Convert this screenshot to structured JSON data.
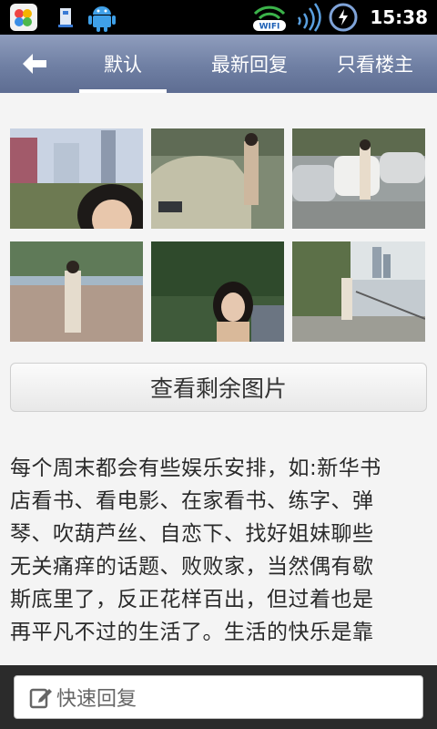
{
  "status_bar": {
    "time": "15:38",
    "wifi_label": "WIFI",
    "icons": [
      "app-store-icon",
      "usb-icon",
      "android-icon",
      "wifi-icon",
      "signal-icon",
      "battery-charging-icon"
    ]
  },
  "nav": {
    "back_icon": "back-arrow-icon",
    "tabs": [
      {
        "label": "默认",
        "active": true
      },
      {
        "label": "最新回复",
        "active": false
      },
      {
        "label": "只看楼主",
        "active": false
      }
    ]
  },
  "photos": {
    "items": [
      "photo-1",
      "photo-2",
      "photo-3",
      "photo-4",
      "photo-5",
      "photo-6"
    ],
    "more_button_label": "查看剩余图片"
  },
  "post": {
    "lines": [
      "每个周末都会有些娱乐安排，如:新华书",
      "店看书、看电影、在家看书、练字、弹",
      "琴、吹葫芦丝、自恋下、找好姐妹聊些",
      "无关痛痒的话题、败败家，当然偶有歇",
      "斯底里了，反正花样百出，但过着也是",
      "再平凡不过的生活了。生活的快乐是靠"
    ]
  },
  "reply": {
    "placeholder": "快速回复",
    "icon": "edit-icon"
  },
  "colors": {
    "nav_top": "#8f9dbd",
    "nav_bottom": "#5e6d92",
    "reply_bar": "#2b2b2b"
  }
}
